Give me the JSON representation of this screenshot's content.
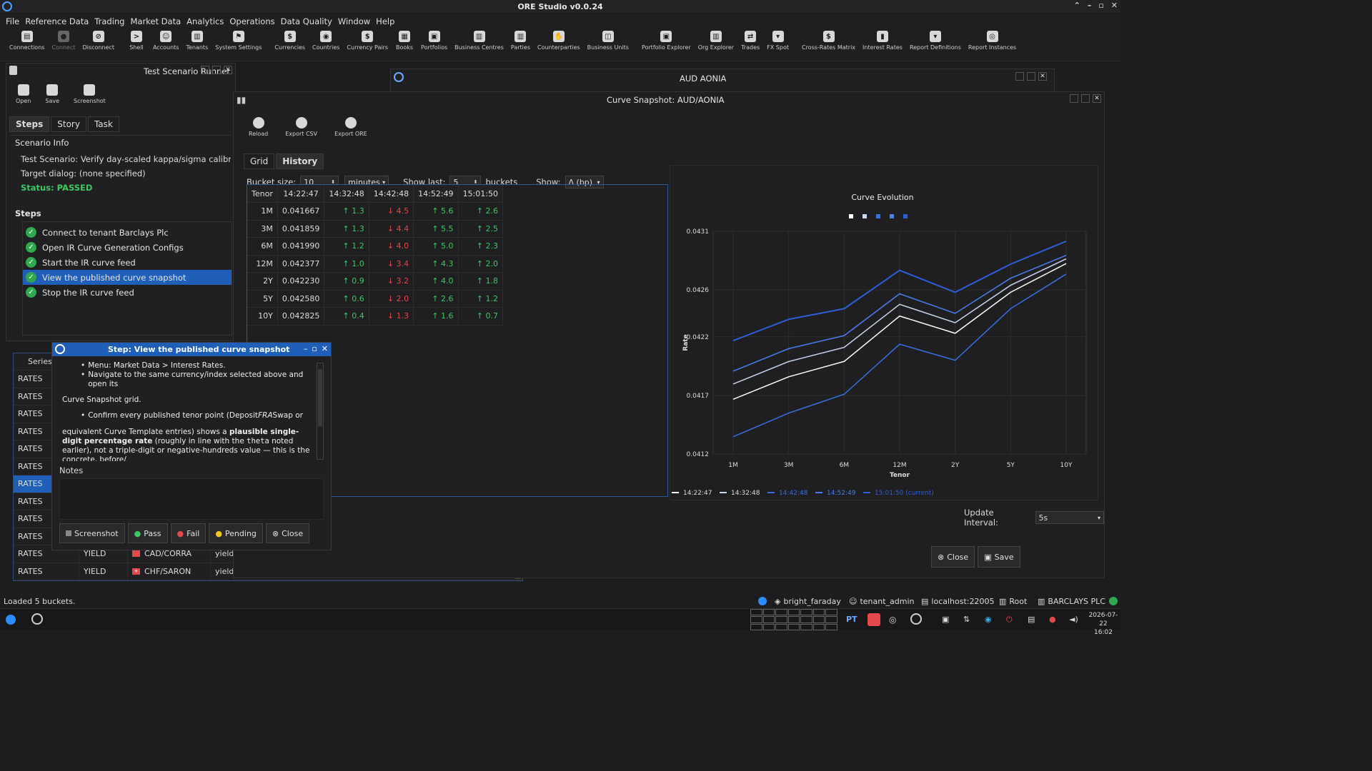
{
  "app": {
    "title": "ORE Studio v0.0.24"
  },
  "menu": [
    "File",
    "Reference Data",
    "Trading",
    "Market Data",
    "Analytics",
    "Operations",
    "Data Quality",
    "Window",
    "Help"
  ],
  "toolbar": [
    {
      "label": "Connections",
      "icon": "connections-icon",
      "glyph": "▤"
    },
    {
      "label": "Connect",
      "icon": "connect-icon",
      "glyph": "●",
      "disabled": true
    },
    {
      "label": "Disconnect",
      "icon": "disconnect-icon",
      "glyph": "⊘"
    },
    {
      "label": "Shell",
      "icon": "shell-icon",
      "glyph": ">"
    },
    {
      "label": "Accounts",
      "icon": "accounts-icon",
      "glyph": "☺"
    },
    {
      "label": "Tenants",
      "icon": "tenants-icon",
      "glyph": "▥"
    },
    {
      "label": "System Settings",
      "icon": "flag-icon",
      "glyph": "⚑"
    },
    {
      "label": "Currencies",
      "icon": "currency-icon",
      "glyph": "$"
    },
    {
      "label": "Countries",
      "icon": "globe-icon",
      "glyph": "◉"
    },
    {
      "label": "Currency Pairs",
      "icon": "currency-pairs-icon",
      "glyph": "$"
    },
    {
      "label": "Books",
      "icon": "books-icon",
      "glyph": "▦"
    },
    {
      "label": "Portfolios",
      "icon": "portfolio-icon",
      "glyph": "▣"
    },
    {
      "label": "Business Centres",
      "icon": "building-icon",
      "glyph": "▥"
    },
    {
      "label": "Parties",
      "icon": "parties-icon",
      "glyph": "▥"
    },
    {
      "label": "Counterparties",
      "icon": "handshake-icon",
      "glyph": "✋"
    },
    {
      "label": "Business Units",
      "icon": "business-units-icon",
      "glyph": "◫"
    },
    {
      "label": "Portfolio Explorer",
      "icon": "portfolio-explorer-icon",
      "glyph": "▣"
    },
    {
      "label": "Org Explorer",
      "icon": "org-explorer-icon",
      "glyph": "▥"
    },
    {
      "label": "Trades",
      "icon": "trades-icon",
      "glyph": "⇄"
    },
    {
      "label": "FX Spot",
      "icon": "fx-spot-icon",
      "glyph": "▾"
    },
    {
      "label": "Cross-Rates Matrix",
      "icon": "cross-rates-icon",
      "glyph": "$"
    },
    {
      "label": "Interest Rates",
      "icon": "bar-chart-icon",
      "glyph": "▮"
    },
    {
      "label": "Report Definitions",
      "icon": "report-definitions-icon",
      "glyph": "▾"
    },
    {
      "label": "Report Instances",
      "icon": "report-instances-icon",
      "glyph": "◎"
    }
  ],
  "runner": {
    "title": "Test Scenario Runner",
    "tools": [
      {
        "label": "Open",
        "icon": "folder-icon"
      },
      {
        "label": "Save",
        "icon": "save-icon"
      },
      {
        "label": "Screenshot",
        "icon": "camera-icon"
      }
    ],
    "tabs": [
      "Steps",
      "Story",
      "Task"
    ],
    "info_header": "Scenario Info",
    "scenario_line": "Test Scenario: Verify day-scaled kappa/sigma calibration fix",
    "target_line": "Target dialog: (none specified)",
    "status_line": "Status: PASSED",
    "steps_header": "Steps",
    "steps": [
      "Connect to tenant Barclays Plc",
      "Open IR Curve Generation Configs",
      "Start the IR curve feed",
      "View the published curve snapshot",
      "Stop the IR curve feed"
    ],
    "selected_step": 3
  },
  "back_list": {
    "header": "Series T",
    "rows": [
      {
        "c1": "RATES"
      },
      {
        "c1": "RATES"
      },
      {
        "c1": "RATES"
      },
      {
        "c1": "RATES"
      },
      {
        "c1": "RATES"
      },
      {
        "c1": "RATES"
      },
      {
        "c1": "RATES",
        "selected": true
      },
      {
        "c1": "RATES"
      },
      {
        "c1": "RATES"
      },
      {
        "c1": "RATES"
      },
      {
        "c1": "RATES",
        "c2": "YIELD",
        "c3": "CAD/CORRA",
        "c4": "yield"
      },
      {
        "c1": "RATES",
        "c2": "YIELD",
        "c3": "CHF/SARON",
        "c4": "yield"
      }
    ]
  },
  "step_dialog": {
    "title": "Step: View the published curve snapshot",
    "bullet1": "Menu: Market Data > Interest Rates.",
    "bullet2": "Navigate to the same currency/index selected above and open its",
    "para1": "Curve Snapshot grid.",
    "bullet3a": "Confirm every published tenor point (Deposit",
    "bullet3b": "FRA",
    "bullet3c": "Swap or",
    "para2a": "equivalent Curve Template entries) shows a ",
    "para2b": "plausible single-digit percentage rate",
    "para2c": " (roughly in line with the ",
    "para2d": "theta",
    "para2e": " noted earlier), not a triple-digit or negative-hundreds value — this is the concrete, before/",
    "notes_label": "Notes",
    "buttons": {
      "screenshot": "Screenshot",
      "pass": "Pass",
      "fail": "Fail",
      "pending": "Pending",
      "close": "Close"
    }
  },
  "aud_window": {
    "title": "AUD AONIA"
  },
  "snapshot": {
    "title": "Curve Snapshot: AUD/AONIA",
    "tools": [
      {
        "label": "Reload",
        "icon": "reload-icon"
      },
      {
        "label": "Export CSV",
        "icon": "export-csv-icon"
      },
      {
        "label": "Export ORE",
        "icon": "export-ore-icon"
      }
    ],
    "tabs": [
      "Grid",
      "History"
    ],
    "bucket_size_label": "Bucket size:",
    "bucket_size": "10",
    "bucket_unit": "minutes",
    "show_last_label": "Show last:",
    "show_last": "5",
    "buckets_label": "buckets",
    "show_label": "Show:",
    "show_value": "Δ (bp)",
    "columns": [
      "Tenor",
      "14:22:47",
      "14:32:48",
      "14:42:48",
      "14:52:49",
      "15:01:50"
    ],
    "rows": [
      {
        "tenor": "1M",
        "base": "0.041667",
        "d": [
          [
            "up",
            "↑ 1.3"
          ],
          [
            "dn",
            "↓ 4.5"
          ],
          [
            "up",
            "↑ 5.6"
          ],
          [
            "up",
            "↑ 2.6"
          ]
        ]
      },
      {
        "tenor": "3M",
        "base": "0.041859",
        "d": [
          [
            "up",
            "↑ 1.3"
          ],
          [
            "dn",
            "↓ 4.4"
          ],
          [
            "up",
            "↑ 5.5"
          ],
          [
            "up",
            "↑ 2.5"
          ]
        ]
      },
      {
        "tenor": "6M",
        "base": "0.041990",
        "d": [
          [
            "up",
            "↑ 1.2"
          ],
          [
            "dn",
            "↓ 4.0"
          ],
          [
            "up",
            "↑ 5.0"
          ],
          [
            "up",
            "↑ 2.3"
          ]
        ]
      },
      {
        "tenor": "12M",
        "base": "0.042377",
        "d": [
          [
            "up",
            "↑ 1.0"
          ],
          [
            "dn",
            "↓ 3.4"
          ],
          [
            "up",
            "↑ 4.3"
          ],
          [
            "up",
            "↑ 2.0"
          ]
        ]
      },
      {
        "tenor": "2Y",
        "base": "0.042230",
        "d": [
          [
            "up",
            "↑ 0.9"
          ],
          [
            "dn",
            "↓ 3.2"
          ],
          [
            "up",
            "↑ 4.0"
          ],
          [
            "up",
            "↑ 1.8"
          ]
        ]
      },
      {
        "tenor": "5Y",
        "base": "0.042580",
        "d": [
          [
            "up",
            "↑ 0.6"
          ],
          [
            "dn",
            "↓ 2.0"
          ],
          [
            "up",
            "↑ 2.6"
          ],
          [
            "up",
            "↑ 1.2"
          ]
        ]
      },
      {
        "tenor": "10Y",
        "base": "0.042825",
        "d": [
          [
            "up",
            "↑ 0.4"
          ],
          [
            "dn",
            "↓ 1.3"
          ],
          [
            "up",
            "↑ 1.6"
          ],
          [
            "up",
            "↑ 0.7"
          ]
        ]
      }
    ],
    "update_interval_label": "Update Interval:",
    "update_interval": "5s",
    "close_label": "Close",
    "save_label": "Save"
  },
  "chart_data": {
    "type": "line",
    "title": "Curve Evolution",
    "xlabel": "Tenor",
    "ylabel": "Rate",
    "categories": [
      "1M",
      "3M",
      "6M",
      "12M",
      "2Y",
      "5Y",
      "10Y"
    ],
    "ylim": [
      0.0412,
      0.0431
    ],
    "yticks": [
      "0.0431",
      "0.0426",
      "0.0422",
      "0.0417",
      "0.0412"
    ],
    "yticks_values": [
      0.0431,
      0.0426,
      0.0422,
      0.0417,
      0.0412
    ],
    "grid": true,
    "legend_position": "bottom",
    "series": [
      {
        "name": "14:22:47",
        "color": "#ffffff",
        "values": [
          0.041667,
          0.041859,
          0.04199,
          0.042377,
          0.04223,
          0.04258,
          0.042825
        ]
      },
      {
        "name": "14:32:48",
        "color": "#c8d8f0",
        "values": [
          0.041797,
          0.041989,
          0.04211,
          0.042477,
          0.04232,
          0.04264,
          0.042865
        ]
      },
      {
        "name": "14:42:48",
        "color": "#3a6fe0",
        "values": [
          0.041347,
          0.041549,
          0.04171,
          0.042137,
          0.042,
          0.04244,
          0.042735
        ]
      },
      {
        "name": "14:52:49",
        "color": "#4a7ff0",
        "values": [
          0.041907,
          0.042099,
          0.04221,
          0.042567,
          0.0424,
          0.0427,
          0.042895
        ]
      },
      {
        "name": "15:01:50 (current)",
        "color": "#2f5fd8",
        "values": [
          0.042167,
          0.042349,
          0.04244,
          0.042767,
          0.04258,
          0.04282,
          0.043015
        ]
      }
    ]
  },
  "status": {
    "message": "Loaded 5 buckets.",
    "user": "bright_faraday",
    "tenant": "tenant_admin",
    "host": "localhost:22005",
    "root": "Root",
    "org": "BARCLAYS PLC"
  },
  "taskbar": {
    "date": "2026-07-22",
    "time": "16:02",
    "lang": "PT"
  }
}
